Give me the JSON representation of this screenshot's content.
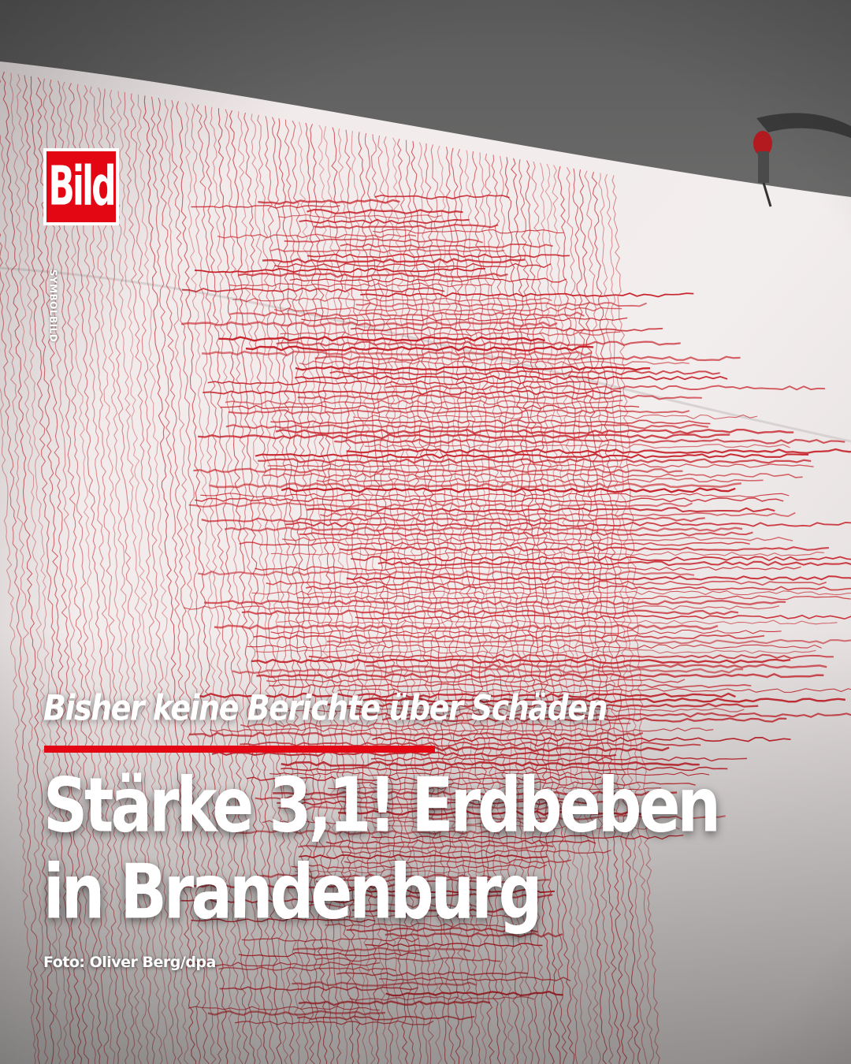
{
  "brand": {
    "logo_text": "Bild",
    "color": "#e30613"
  },
  "side_label": "SYMBOLBILD",
  "photo": {
    "subject": "seismograph",
    "trace_color": "#c41a22"
  },
  "article": {
    "kicker": "Bisher keine Berichte über Schäden",
    "headline_line1": "Stärke 3,1! Erdbeben",
    "headline_line2": "in Brandenburg"
  },
  "credit": "Foto: Oliver Berg/dpa"
}
